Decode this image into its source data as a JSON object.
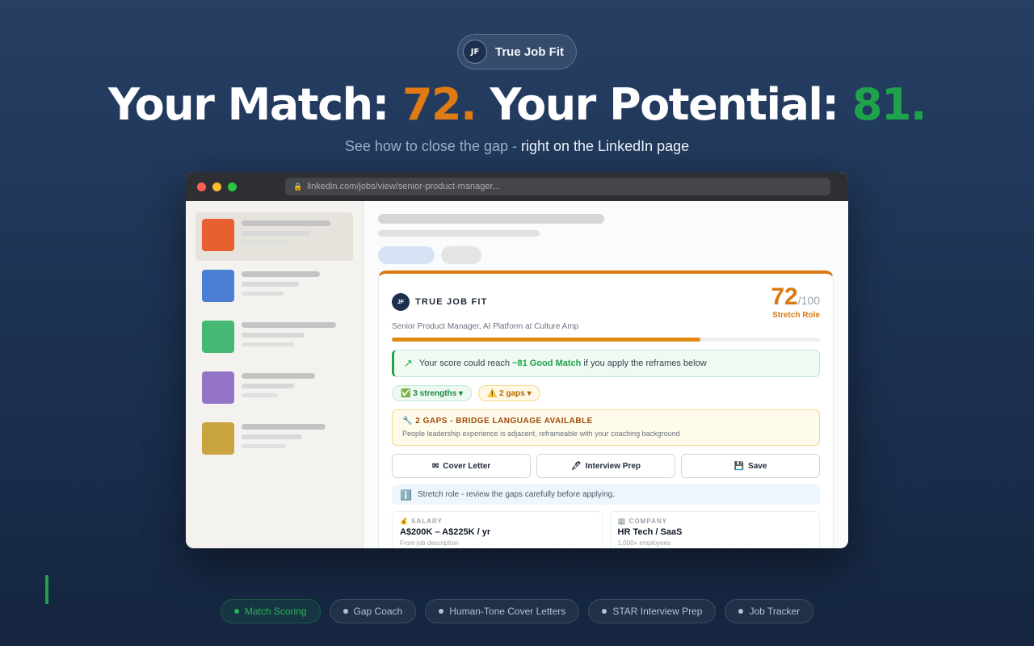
{
  "brand": {
    "logo": "JF",
    "name": "True Job Fit"
  },
  "headline": {
    "part1": "Your Match: ",
    "match": "72.",
    "part2": " Your Potential: ",
    "potential": "81."
  },
  "subheadline": {
    "lead": "See how to close the gap - ",
    "highlight": "right on the LinkedIn page"
  },
  "browser": {
    "url": "linkedin.com/jobs/view/senior-product-manager..."
  },
  "sidebar": {
    "thumb_colors": [
      "#e8602f",
      "#4b7fd4",
      "#46b873",
      "#9474c7",
      "#c9a43e"
    ]
  },
  "card": {
    "logo": "JF",
    "brand": "TRUE JOB FIT",
    "score": "72",
    "score_max": "/100",
    "score_label": "Stretch Role",
    "role": "Senior Product Manager, AI Platform at Culture Amp",
    "progress_fraction": 0.72,
    "reach": {
      "lead": "Your score could reach ",
      "strong": "~81 Good Match",
      "tail": " if you apply the reframes below"
    },
    "chips": {
      "strengths": "✅ 3 strengths ▾",
      "gaps": "⚠️ 2 gaps ▾"
    },
    "gaps_box": {
      "title": "🔧 2 GAPS - BRIDGE LANGUAGE AVAILABLE",
      "desc": "People leadership experience is adjacent, reframeable with your coaching background"
    },
    "actions": {
      "cover_letter_icon": "✉",
      "cover_letter": "Cover Letter",
      "interview_icon": "🖊",
      "interview": "Interview Prep",
      "save_icon": "💾",
      "save": "Save"
    },
    "notice": "Stretch role - review the gaps carefully before applying.",
    "salary": {
      "label": "💰 SALARY",
      "value": "A$200K – A$225K / yr",
      "sub": "From job description"
    },
    "company": {
      "label": "🏢 COMPANY",
      "value": "HR Tech / SaaS",
      "sub": "1,000+ employees"
    }
  },
  "features": [
    "Match Scoring",
    "Gap Coach",
    "Human-Tone Cover Letters",
    "STAR Interview Prep",
    "Job Tracker"
  ],
  "colors": {
    "accent_orange": "#d97a10",
    "accent_green": "#1fa34a",
    "background": "#1d3354"
  }
}
